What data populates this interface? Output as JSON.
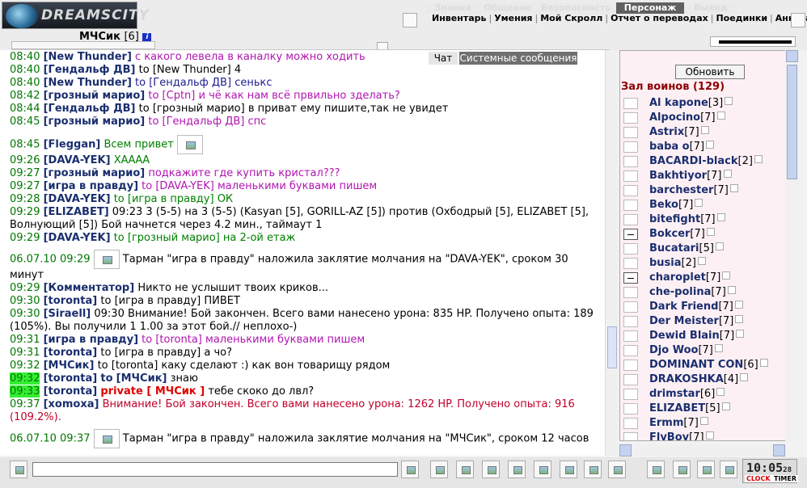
{
  "header": {
    "brand": "DREAMSCITY",
    "user_name": "МЧСик",
    "user_level": "[6]",
    "info_icon_glyph": "i",
    "tabs": [
      {
        "label": "Знания",
        "active": false
      },
      {
        "label": "Общение",
        "active": false
      },
      {
        "label": "Безопасность",
        "active": false
      },
      {
        "label": "Персонаж",
        "active": true
      },
      {
        "label": "Выход",
        "active": false
      }
    ],
    "submenu": [
      "Инвентарь",
      "Умения",
      "Мой Скролл",
      "Отчет о переводах",
      "Поединки",
      "Анкета"
    ],
    "submenu_sep": "|"
  },
  "chat_tabs": [
    {
      "label": "Чат",
      "active": true
    },
    {
      "label": "Системные сообщения",
      "active": false
    }
  ],
  "chat": {
    "to_word": "to",
    "private_label": "private [ МЧСик ]",
    "messages": [
      {
        "t": "08:40",
        "nick": "[New Thunder]",
        "text": "с какого левела в каналку можно ходить",
        "color": "c-mag"
      },
      {
        "t": "08:40",
        "nick": "[Гендальф ДВ]",
        "to": "[New Thunder]",
        "text": "4",
        "color": "c-def"
      },
      {
        "t": "08:40",
        "nick": "[New Thunder]",
        "to": "[Гендальф ДВ]",
        "text": "сенькс",
        "color": "c-blue"
      },
      {
        "t": "08:42",
        "nick": "[грозный марио]",
        "to": "[Cptn]",
        "text": "и чё как нам всё првильно зделать?",
        "color": "c-mag"
      },
      {
        "t": "08:44",
        "nick": "[Гендальф ДВ]",
        "to": "[грозный марио]",
        "text": "в приват ему пишите,так не увидет",
        "color": "c-def"
      },
      {
        "t": "08:45",
        "nick": "[грозный марио]",
        "to": "[Гендальф ДВ]",
        "text": "спс",
        "color": "c-mag"
      },
      {
        "t": "08:45",
        "nick": "[Fleggan]",
        "text": "Всем привет",
        "color": "c-green",
        "img": true,
        "tall": true
      },
      {
        "t": "09:26",
        "nick": "[DAVA-YEK]",
        "text": "ХАААА",
        "color": "c-green"
      },
      {
        "t": "09:27",
        "nick": "[грозный марио]",
        "text": "подкажите где купить кристал???",
        "color": "c-mag"
      },
      {
        "t": "09:27",
        "nick": "[игра в правду]",
        "to": "[DAVA-YEK]",
        "text": "маленькими буквами пишем",
        "color": "c-mag"
      },
      {
        "t": "09:28",
        "nick": "[DAVA-YEK]",
        "to": "[игра в правду]",
        "text": "ОК",
        "color": "c-green"
      },
      {
        "t": "09:29",
        "nick": "[ELIZABET]",
        "text": "09:23 3 (5-5) на 3 (5-5) (Kasyan [5], GORILL-AZ [5]) против (Охбодрый [5], ELIZABET [5], Волнующий [5]) Бой начнется через 4.2 мин., таймаут 1",
        "color": "c-def"
      },
      {
        "t": "09:29",
        "nick": "[DAVA-YEK]",
        "to": "[грозный марио]",
        "text": "на 2-ой етаж",
        "color": "c-green"
      },
      {
        "sys": true,
        "date": "06.07.10 09:29",
        "text": "Тарман \"игра в правду\" наложила заклятие молчания на \"DAVA-YEK\", сроком 30 минут"
      },
      {
        "t": "09:29",
        "nick": "[Комментатор]",
        "text": "Никто не услышит твоих криков...",
        "color": "c-def"
      },
      {
        "t": "09:30",
        "nick": "[toronta]",
        "to": "[игра в правду]",
        "text": "ПИВЕТ",
        "color": "c-def"
      },
      {
        "t": "09:30",
        "nick": "[Siraell]",
        "text": "09:30 Внимание! Бой закончен. Всего вами нанесено урона: 835 HP. Получено опыта: 189 (105%). Вы получили 1 1.00 за этот бой.// неплохо-)",
        "color": "c-def"
      },
      {
        "t": "09:31",
        "nick": "[игра в правду]",
        "to": "[toronta]",
        "text": "маленькими буквами пишем",
        "color": "c-mag"
      },
      {
        "t": "09:31",
        "nick": "[toronta]",
        "to": "[игра в правду]",
        "text": "а чо?",
        "color": "c-def"
      },
      {
        "t": "09:32",
        "nick": "[МЧСик]",
        "to": "[toronta]",
        "text": "каку сделают :) как вон товарищу рядом",
        "color": "c-def"
      },
      {
        "t": "09:32",
        "nick": "[toronta]",
        "to_me": "[МЧСик]",
        "text": "знаю",
        "color": "c-def",
        "hl": true
      },
      {
        "t": "09:33",
        "nick": "[toronta]",
        "private": true,
        "text": "тебе скоко до лвл?",
        "color": "c-def",
        "hl": true
      },
      {
        "t": "09:37",
        "nick": "[xomoxa]",
        "text": "Внимание! Бой закончен. Всего вами нанесено урона: 1262 HP. Получено опыта: 916 (109.2%).",
        "color": "c-red"
      },
      {
        "sys": true,
        "date": "06.07.10 09:37",
        "text": "Тарман \"игра в правду\" наложила заклятие молчания на \"МЧСик\", сроком 12 часов"
      }
    ]
  },
  "right_panel": {
    "refresh_label": "Обновить",
    "hall_title": "Зал воинов (129)",
    "players": [
      {
        "name": "Al kapone",
        "level": "[3]",
        "minus": false
      },
      {
        "name": "Alpocino",
        "level": "[7]",
        "minus": false
      },
      {
        "name": "Astrix",
        "level": "[7]",
        "minus": false
      },
      {
        "name": "baba o",
        "level": "[7]",
        "minus": false
      },
      {
        "name": "BACARDI-black",
        "level": "[2]",
        "minus": false
      },
      {
        "name": "Bakhtiyor",
        "level": "[7]",
        "minus": false
      },
      {
        "name": "barchester",
        "level": "[7]",
        "minus": false
      },
      {
        "name": "Beko",
        "level": "[7]",
        "minus": false
      },
      {
        "name": "bitefight",
        "level": "[7]",
        "minus": false
      },
      {
        "name": "Bokcer",
        "level": "[7]",
        "minus": true
      },
      {
        "name": "Bucatari",
        "level": "[5]",
        "minus": false
      },
      {
        "name": "busia",
        "level": "[2]",
        "minus": false
      },
      {
        "name": "charoplet",
        "level": "[7]",
        "minus": true
      },
      {
        "name": "che-polina",
        "level": "[7]",
        "minus": false
      },
      {
        "name": "Dark Friend",
        "level": "[7]",
        "minus": false
      },
      {
        "name": "Der Meister",
        "level": "[7]",
        "minus": false
      },
      {
        "name": "Dewid Blain",
        "level": "[7]",
        "minus": false
      },
      {
        "name": "Djo Woo",
        "level": "[7]",
        "minus": false
      },
      {
        "name": "DOMINANT CON",
        "level": "[6]",
        "minus": false
      },
      {
        "name": "DRAKOSHKA",
        "level": "[4]",
        "minus": false
      },
      {
        "name": "drimstar",
        "level": "[6]",
        "minus": false
      },
      {
        "name": "ELIZABET",
        "level": "[5]",
        "minus": false
      },
      {
        "name": "Ermm",
        "level": "[7]",
        "minus": false
      },
      {
        "name": "FlyBoy",
        "level": "[7]",
        "minus": false
      }
    ]
  },
  "bottom": {
    "chat_input_value": "",
    "clock_time": "10:05",
    "clock_seconds": "28",
    "clock_label": "CLOCK",
    "timer_label": "TIMER"
  },
  "icons": {
    "scroll_up": "▲",
    "scroll_down": "▼",
    "scroll_left": "◀",
    "scroll_right": "▶"
  }
}
